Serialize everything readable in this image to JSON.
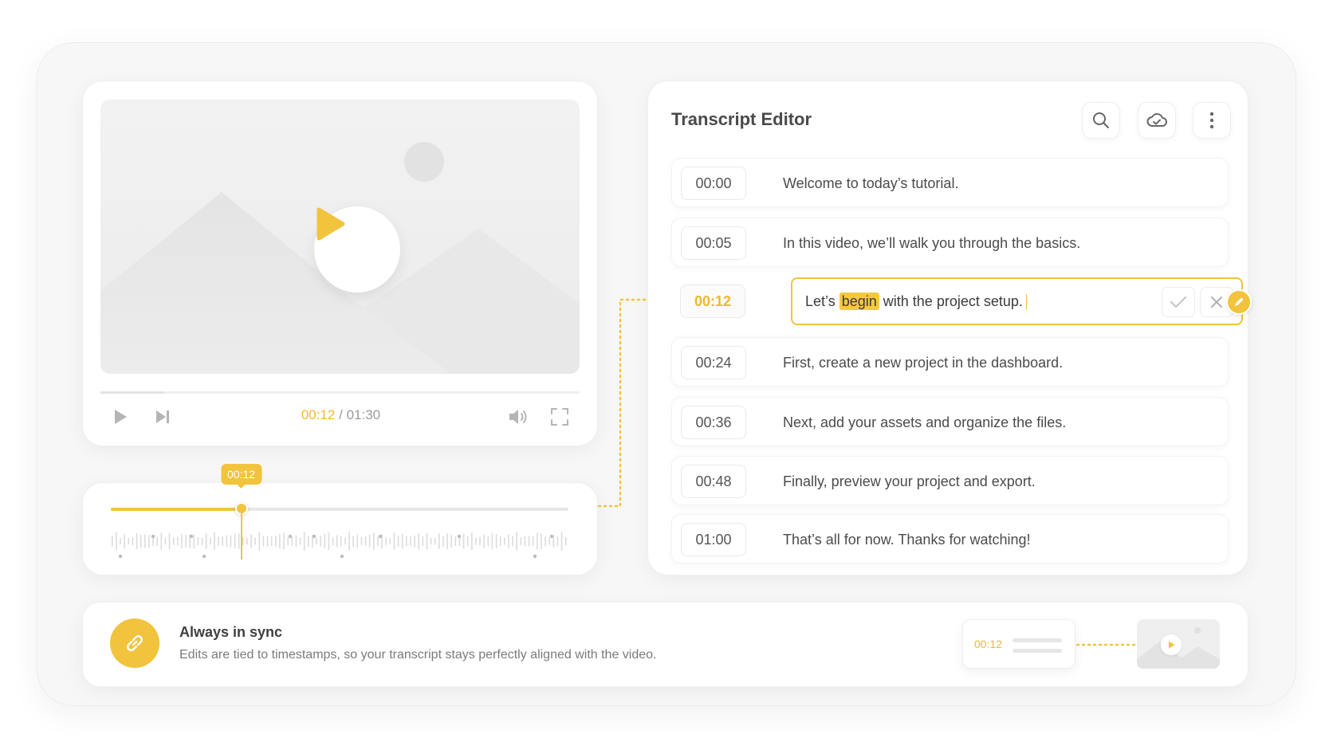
{
  "player": {
    "current_time": "00:12",
    "separator": "/",
    "duration": "01:30",
    "progress_fraction": 0.133
  },
  "timeline": {
    "tooltip": "00:12",
    "position_fraction": 0.285
  },
  "editor": {
    "title": "Transcript Editor",
    "rows": [
      {
        "time": "00:00",
        "text": "Welcome to today’s tutorial."
      },
      {
        "time": "00:05",
        "text": "In this video, we’ll walk you through the basics."
      },
      {
        "time": "00:12",
        "text_before": "Let’s",
        "highlight": "begin",
        "text_after": "with the project setup."
      },
      {
        "time": "00:24",
        "text": "First, create a new project in the dashboard."
      },
      {
        "time": "00:36",
        "text": "Next, add your assets and organize the files."
      },
      {
        "time": "00:48",
        "text": "Finally, preview your project and export."
      },
      {
        "time": "01:00",
        "text": "That’s all for now. Thanks for watching!"
      }
    ],
    "active_row": 2
  },
  "sync": {
    "title": "Always in sync",
    "description": "Edits are tied to timestamps, so your transcript stays perfectly aligned with the video.",
    "mini_timestamp": "00:12"
  },
  "colors": {
    "accent": "#f2c33c",
    "accent_text": "#f0b92a",
    "muted": "#9a9a9a"
  },
  "icons": {
    "play": "play-icon",
    "skip": "skip-forward-icon",
    "volume": "volume-icon",
    "fullscreen": "fullscreen-icon",
    "search": "search-icon",
    "cloud": "cloud-icon",
    "more": "more-vertical-icon",
    "confirm": "check-icon",
    "cancel": "close-icon",
    "edit": "pencil-icon",
    "link": "link-icon"
  }
}
